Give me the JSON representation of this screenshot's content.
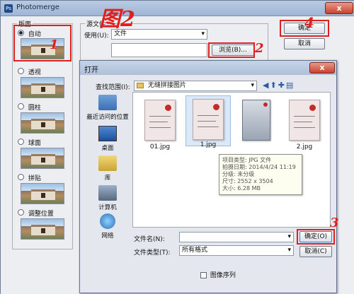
{
  "photomerge": {
    "title": "Photomerge",
    "layout_group": "版面",
    "layouts": [
      "自动",
      "透视",
      "圆柱",
      "球面",
      "拼贴",
      "调整位置"
    ],
    "source_group": "源文件",
    "use_label": "使用(U):",
    "use_value": "文件",
    "browse_button": "浏览(B)...",
    "ok_button": "确定",
    "cancel_button": "取消",
    "close_glyph": "x"
  },
  "annotations": {
    "step1": "1",
    "step2": "2",
    "step3": "3",
    "step4": "4",
    "handwritten_title": "图2"
  },
  "open_dialog": {
    "title": "打开",
    "lookin_label": "查找范围(I):",
    "lookin_value": "无缝拼接图片",
    "places": [
      "最近访问的位置",
      "桌面",
      "库",
      "计算机",
      "网络"
    ],
    "files": [
      "01.jpg",
      "1.jpg",
      "",
      "2.jpg"
    ],
    "tooltip": {
      "type": "项目类型: JPG 文件",
      "date": "拍摄日期: 2014/4/24 11:19",
      "rating": "分级: 未分级",
      "size": "尺寸: 2552 x 3504",
      "filesize": "大小: 6.28 MB"
    },
    "filename_label": "文件名(N):",
    "filename_value": "",
    "filetype_label": "文件类型(T):",
    "filetype_value": "所有格式",
    "open_button": "确定(O)",
    "cancel_button": "取消(C)",
    "sequence_label": "图像序列",
    "close_glyph": "x"
  },
  "colors": {
    "annotation": "#e01f1f",
    "titlebar": "#aebfd8"
  }
}
